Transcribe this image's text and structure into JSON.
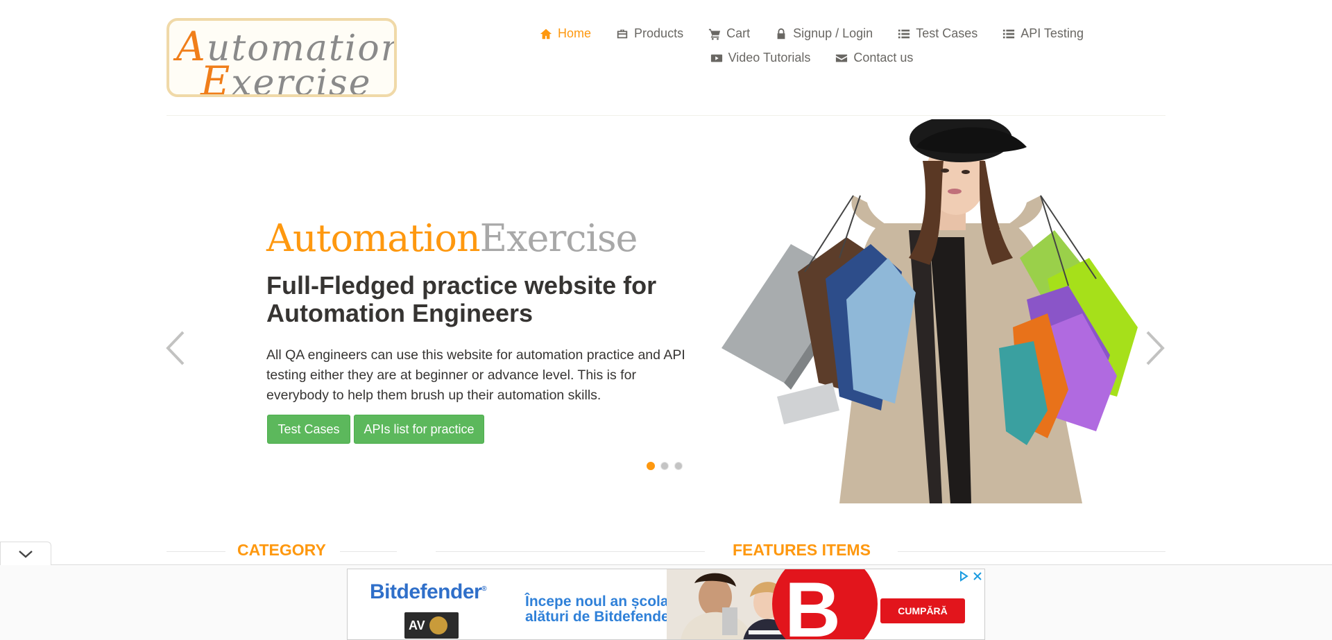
{
  "logo": {
    "line1_cap": "A",
    "line1_rest": "utomation",
    "line2_cap": "E",
    "line2_rest": "xercise"
  },
  "nav": {
    "items": [
      {
        "label": "Home",
        "icon": "home-icon",
        "active": true
      },
      {
        "label": "Products",
        "icon": "products-icon"
      },
      {
        "label": "Cart",
        "icon": "cart-icon"
      },
      {
        "label": "Signup / Login",
        "icon": "lock-icon"
      },
      {
        "label": "Test Cases",
        "icon": "list-icon"
      },
      {
        "label": "API Testing",
        "icon": "list-icon"
      },
      {
        "label": "Video Tutorials",
        "icon": "youtube-icon"
      },
      {
        "label": "Contact us",
        "icon": "envelope-icon"
      }
    ]
  },
  "slider": {
    "brand_part1": "Automation",
    "brand_part2": "Exercise",
    "headline": "Full-Fledged practice website for Automation Engineers",
    "description": "All QA engineers can use this website for automation practice and API testing either they are at beginner or advance level. This is for everybody to help them brush up their automation skills.",
    "button_test_cases": "Test Cases",
    "button_apis": "APIs list for practice",
    "active_slide": 1,
    "slide_count": 3
  },
  "sections": {
    "category": "CATEGORY",
    "features": "FEATURES ITEMS"
  },
  "ad": {
    "brand": "Bitdefender",
    "registered": "®",
    "av_badge": "AV",
    "text_line1": "Începe noul an școlar",
    "text_line2": "alături de Bitdefender!",
    "big_letter": "B",
    "cta": "CUMPĂRĂ"
  },
  "colors": {
    "accent": "#fe980f",
    "button_green": "#5cb85c",
    "ad_red": "#e2151c",
    "ad_blue": "#2f6fc9"
  }
}
